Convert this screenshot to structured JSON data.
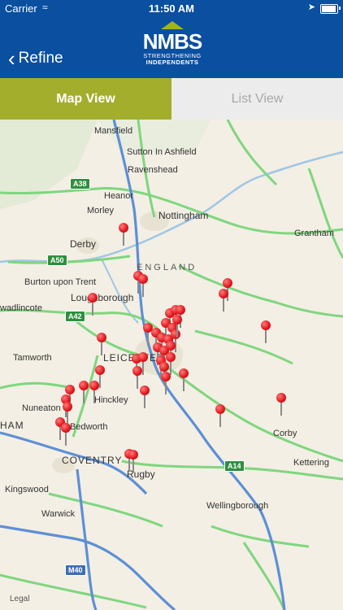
{
  "status_bar": {
    "carrier": "Carrier",
    "time": "11:50 AM"
  },
  "nav": {
    "back_label": "Refine"
  },
  "logo": {
    "letters": "NMBS",
    "strap_line1": "STRENGTHENING",
    "strap_line2": "INDEPENDENTS"
  },
  "tabs": [
    {
      "label": "Map View",
      "active": true
    },
    {
      "label": "List View",
      "active": false
    }
  ],
  "map": {
    "region_label": "ENGLAND",
    "places": [
      "Mansfield",
      "Sutton In Ashfield",
      "Ravenshead",
      "Heanor",
      "Morley",
      "Nottingham",
      "Derby",
      "Grantham",
      "Burton upon Trent",
      "Loughborough",
      "wadlincote",
      "Tamworth",
      "LEICESTER",
      "Nuneaton",
      "Hinckley",
      "Bedworth",
      "COVENTRY",
      "Rugby",
      "Kingswood",
      "Warwick",
      "Corby",
      "Kettering",
      "Wellingborough",
      "HAM"
    ],
    "roads": [
      "A38",
      "A50",
      "A42",
      "A14",
      "M40"
    ],
    "legal": "Legal",
    "marker_count": 43
  },
  "colors": {
    "brand_blue": "#0a4fa0",
    "tab_active": "#a3ae2c",
    "tab_inactive": "#ececec",
    "pin": "#e0141b"
  }
}
